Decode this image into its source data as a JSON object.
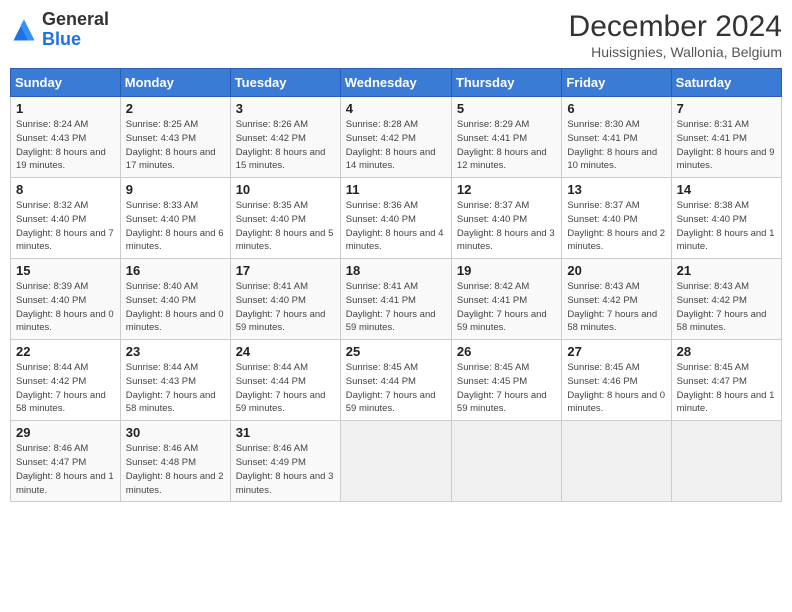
{
  "logo": {
    "general": "General",
    "blue": "Blue"
  },
  "header": {
    "month": "December 2024",
    "location": "Huissignies, Wallonia, Belgium"
  },
  "days_of_week": [
    "Sunday",
    "Monday",
    "Tuesday",
    "Wednesday",
    "Thursday",
    "Friday",
    "Saturday"
  ],
  "weeks": [
    [
      {
        "day": 1,
        "sunrise": "8:24 AM",
        "sunset": "4:43 PM",
        "daylight": "8 hours and 19 minutes."
      },
      {
        "day": 2,
        "sunrise": "8:25 AM",
        "sunset": "4:43 PM",
        "daylight": "8 hours and 17 minutes."
      },
      {
        "day": 3,
        "sunrise": "8:26 AM",
        "sunset": "4:42 PM",
        "daylight": "8 hours and 15 minutes."
      },
      {
        "day": 4,
        "sunrise": "8:28 AM",
        "sunset": "4:42 PM",
        "daylight": "8 hours and 14 minutes."
      },
      {
        "day": 5,
        "sunrise": "8:29 AM",
        "sunset": "4:41 PM",
        "daylight": "8 hours and 12 minutes."
      },
      {
        "day": 6,
        "sunrise": "8:30 AM",
        "sunset": "4:41 PM",
        "daylight": "8 hours and 10 minutes."
      },
      {
        "day": 7,
        "sunrise": "8:31 AM",
        "sunset": "4:41 PM",
        "daylight": "8 hours and 9 minutes."
      }
    ],
    [
      {
        "day": 8,
        "sunrise": "8:32 AM",
        "sunset": "4:40 PM",
        "daylight": "8 hours and 7 minutes."
      },
      {
        "day": 9,
        "sunrise": "8:33 AM",
        "sunset": "4:40 PM",
        "daylight": "8 hours and 6 minutes."
      },
      {
        "day": 10,
        "sunrise": "8:35 AM",
        "sunset": "4:40 PM",
        "daylight": "8 hours and 5 minutes."
      },
      {
        "day": 11,
        "sunrise": "8:36 AM",
        "sunset": "4:40 PM",
        "daylight": "8 hours and 4 minutes."
      },
      {
        "day": 12,
        "sunrise": "8:37 AM",
        "sunset": "4:40 PM",
        "daylight": "8 hours and 3 minutes."
      },
      {
        "day": 13,
        "sunrise": "8:37 AM",
        "sunset": "4:40 PM",
        "daylight": "8 hours and 2 minutes."
      },
      {
        "day": 14,
        "sunrise": "8:38 AM",
        "sunset": "4:40 PM",
        "daylight": "8 hours and 1 minute."
      }
    ],
    [
      {
        "day": 15,
        "sunrise": "8:39 AM",
        "sunset": "4:40 PM",
        "daylight": "8 hours and 0 minutes."
      },
      {
        "day": 16,
        "sunrise": "8:40 AM",
        "sunset": "4:40 PM",
        "daylight": "8 hours and 0 minutes."
      },
      {
        "day": 17,
        "sunrise": "8:41 AM",
        "sunset": "4:40 PM",
        "daylight": "7 hours and 59 minutes."
      },
      {
        "day": 18,
        "sunrise": "8:41 AM",
        "sunset": "4:41 PM",
        "daylight": "7 hours and 59 minutes."
      },
      {
        "day": 19,
        "sunrise": "8:42 AM",
        "sunset": "4:41 PM",
        "daylight": "7 hours and 59 minutes."
      },
      {
        "day": 20,
        "sunrise": "8:43 AM",
        "sunset": "4:42 PM",
        "daylight": "7 hours and 58 minutes."
      },
      {
        "day": 21,
        "sunrise": "8:43 AM",
        "sunset": "4:42 PM",
        "daylight": "7 hours and 58 minutes."
      }
    ],
    [
      {
        "day": 22,
        "sunrise": "8:44 AM",
        "sunset": "4:42 PM",
        "daylight": "7 hours and 58 minutes."
      },
      {
        "day": 23,
        "sunrise": "8:44 AM",
        "sunset": "4:43 PM",
        "daylight": "7 hours and 58 minutes."
      },
      {
        "day": 24,
        "sunrise": "8:44 AM",
        "sunset": "4:44 PM",
        "daylight": "7 hours and 59 minutes."
      },
      {
        "day": 25,
        "sunrise": "8:45 AM",
        "sunset": "4:44 PM",
        "daylight": "7 hours and 59 minutes."
      },
      {
        "day": 26,
        "sunrise": "8:45 AM",
        "sunset": "4:45 PM",
        "daylight": "7 hours and 59 minutes."
      },
      {
        "day": 27,
        "sunrise": "8:45 AM",
        "sunset": "4:46 PM",
        "daylight": "8 hours and 0 minutes."
      },
      {
        "day": 28,
        "sunrise": "8:45 AM",
        "sunset": "4:47 PM",
        "daylight": "8 hours and 1 minute."
      }
    ],
    [
      {
        "day": 29,
        "sunrise": "8:46 AM",
        "sunset": "4:47 PM",
        "daylight": "8 hours and 1 minute."
      },
      {
        "day": 30,
        "sunrise": "8:46 AM",
        "sunset": "4:48 PM",
        "daylight": "8 hours and 2 minutes."
      },
      {
        "day": 31,
        "sunrise": "8:46 AM",
        "sunset": "4:49 PM",
        "daylight": "8 hours and 3 minutes."
      },
      null,
      null,
      null,
      null
    ]
  ]
}
